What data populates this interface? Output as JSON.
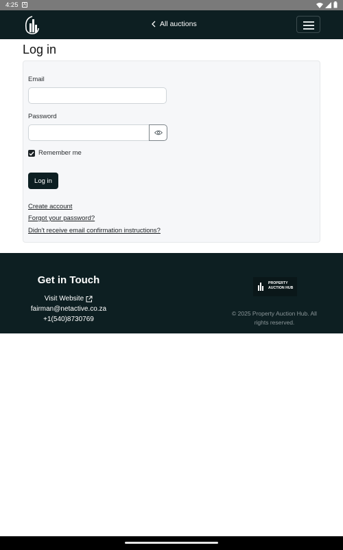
{
  "status_bar": {
    "time": "4:25",
    "notification_letter": "A"
  },
  "header": {
    "back_label": "All auctions"
  },
  "page": {
    "title": "Log in"
  },
  "form": {
    "email_label": "Email",
    "email_value": "",
    "password_label": "Password",
    "password_value": "",
    "remember_label": "Remember me",
    "remember_checked": true,
    "submit_label": "Log in"
  },
  "links": [
    "Create account",
    "Forgot your password?",
    "Didn't receive email confirmation instructions?"
  ],
  "footer": {
    "heading": "Get in Touch",
    "visit_label": "Visit Website",
    "email": "fairman@netactive.co.za",
    "phone": "+1(540)8730769",
    "brand_line1": "PROPERTY",
    "brand_line2": "AUCTION HUB",
    "copyright_line1": "© 2025 Property Auction Hub. All",
    "copyright_line2": "rights reserved."
  },
  "colors": {
    "header_bg": "#0d1f22",
    "card_bg": "#f6f7f9",
    "button_bg": "#0d1f22"
  }
}
